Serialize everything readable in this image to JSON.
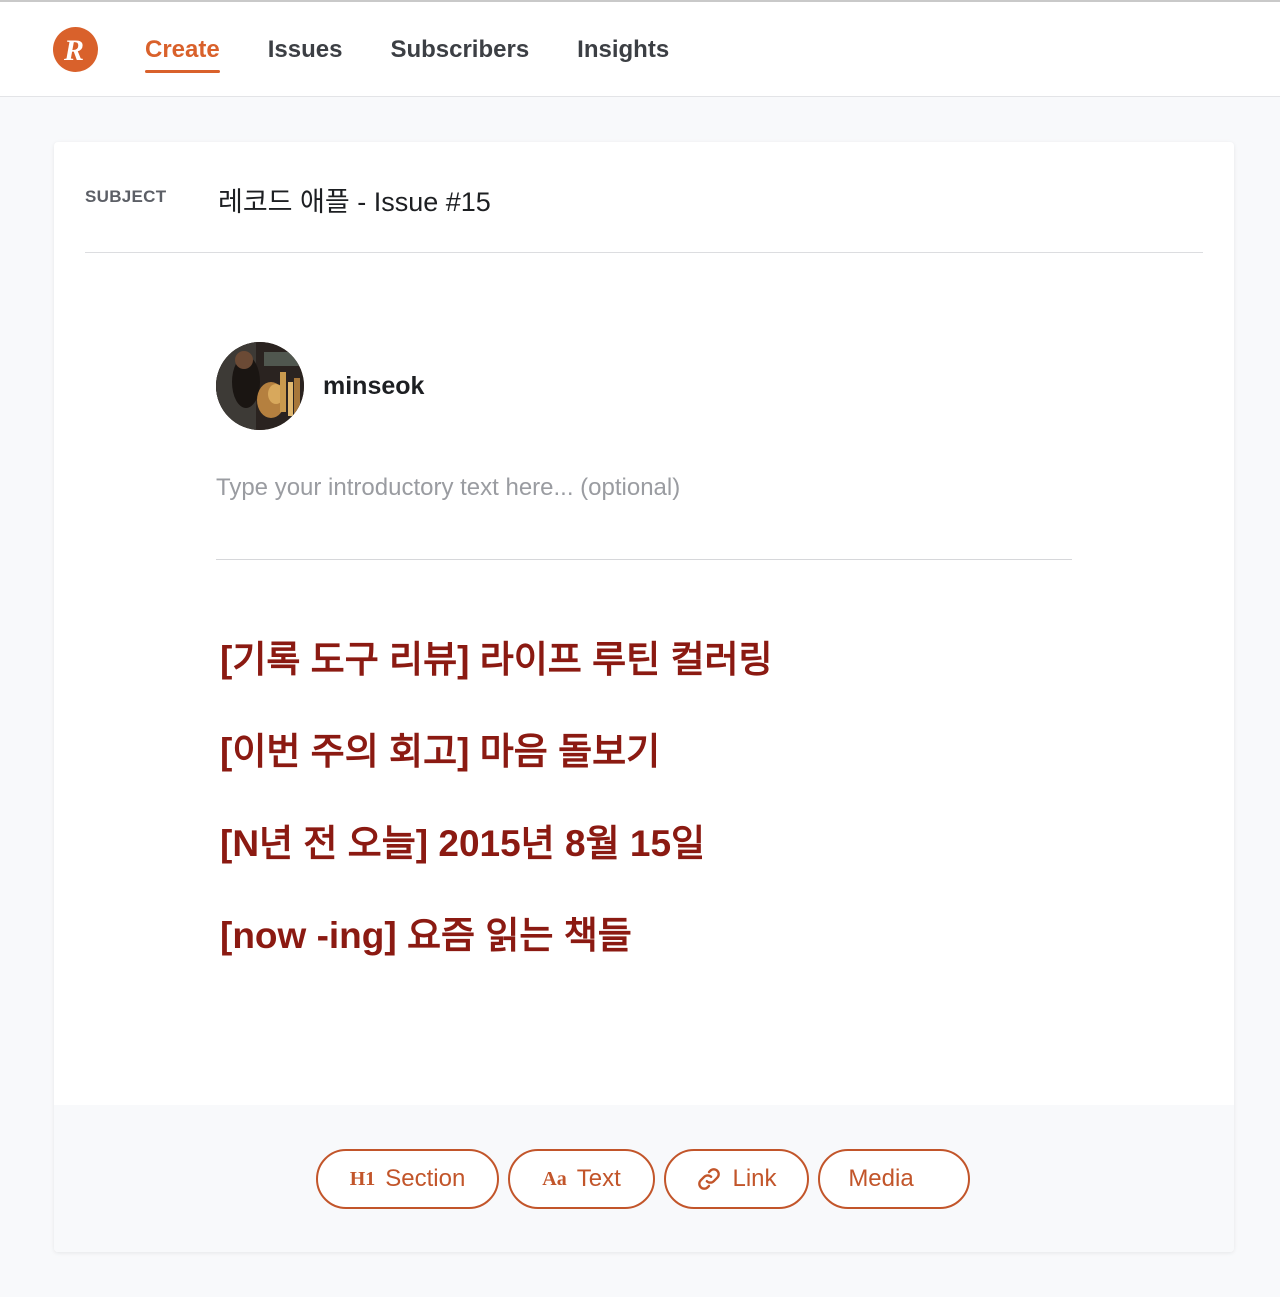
{
  "app": {
    "logo_letter": "R",
    "accent_color": "#d9612b",
    "heading_color": "#8b1a12"
  },
  "nav": {
    "items": [
      {
        "label": "Create",
        "active": true
      },
      {
        "label": "Issues",
        "active": false
      },
      {
        "label": "Subscribers",
        "active": false
      },
      {
        "label": "Insights",
        "active": false
      }
    ]
  },
  "editor": {
    "subject_label": "SUBJECT",
    "subject_value": "레코드 애플 - Issue #15",
    "author_name": "minseok",
    "intro_placeholder": "Type your introductory text here... (optional)",
    "intro_value": "",
    "sections": [
      "[기록 도구 리뷰] 라이프 루틴 컬러링",
      "[이번 주의 회고] 마음 돌보기",
      "[N년 전 오늘] 2015년 8월 15일",
      "[now -ing] 요즘 읽는 책들"
    ]
  },
  "toolbar": {
    "section": {
      "icon_text": "H1",
      "label": "Section"
    },
    "text": {
      "icon_text": "Aa",
      "label": "Text"
    },
    "link": {
      "icon": "link-icon",
      "label": "Link"
    },
    "media": {
      "label": "Media",
      "icon": "chevron-up-icon"
    }
  }
}
